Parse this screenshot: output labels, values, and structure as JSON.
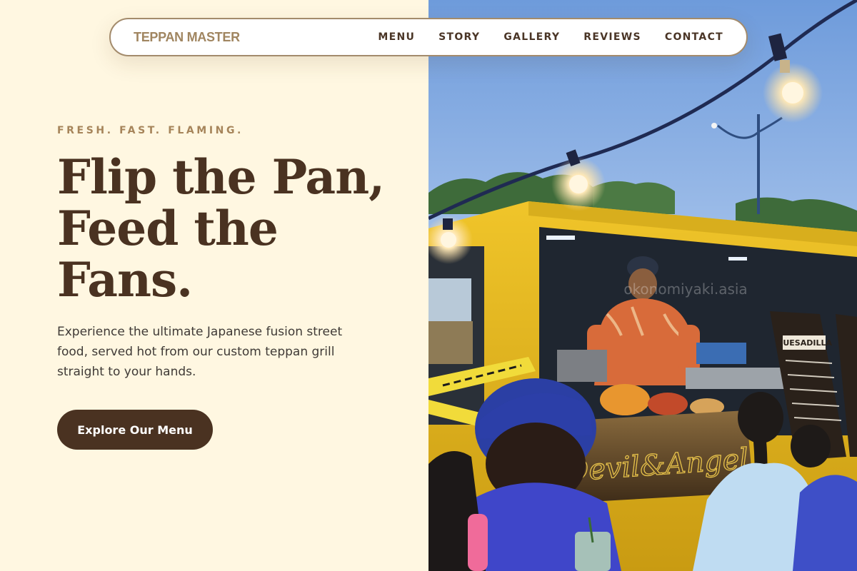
{
  "nav": {
    "brand": "TEPPAN MASTER",
    "links": [
      "MENU",
      "STORY",
      "GALLERY",
      "REVIEWS",
      "CONTACT"
    ]
  },
  "hero": {
    "eyebrow": "FRESH. FAST. FLAMING.",
    "headline_lines": [
      "Flip the Pan,",
      "Feed the",
      "Fans."
    ],
    "lead": "Experience the ultimate Japanese fusion street food, served hot from our custom teppan grill straight to your hands.",
    "cta_label": "Explore Our Menu"
  },
  "photo": {
    "sign_text": "QUESADILLA",
    "truck_script": "Devil&Angel",
    "watermark": "okonomiyaki.asia"
  },
  "colors": {
    "cream_bg": "#FFF7E1",
    "brown_dark": "#4A3221",
    "brand_tan": "#A08560",
    "eyebrow_tan": "#A6845A",
    "truck_yellow": "#E2B51E",
    "sky_blue": "#7FA9E0"
  }
}
